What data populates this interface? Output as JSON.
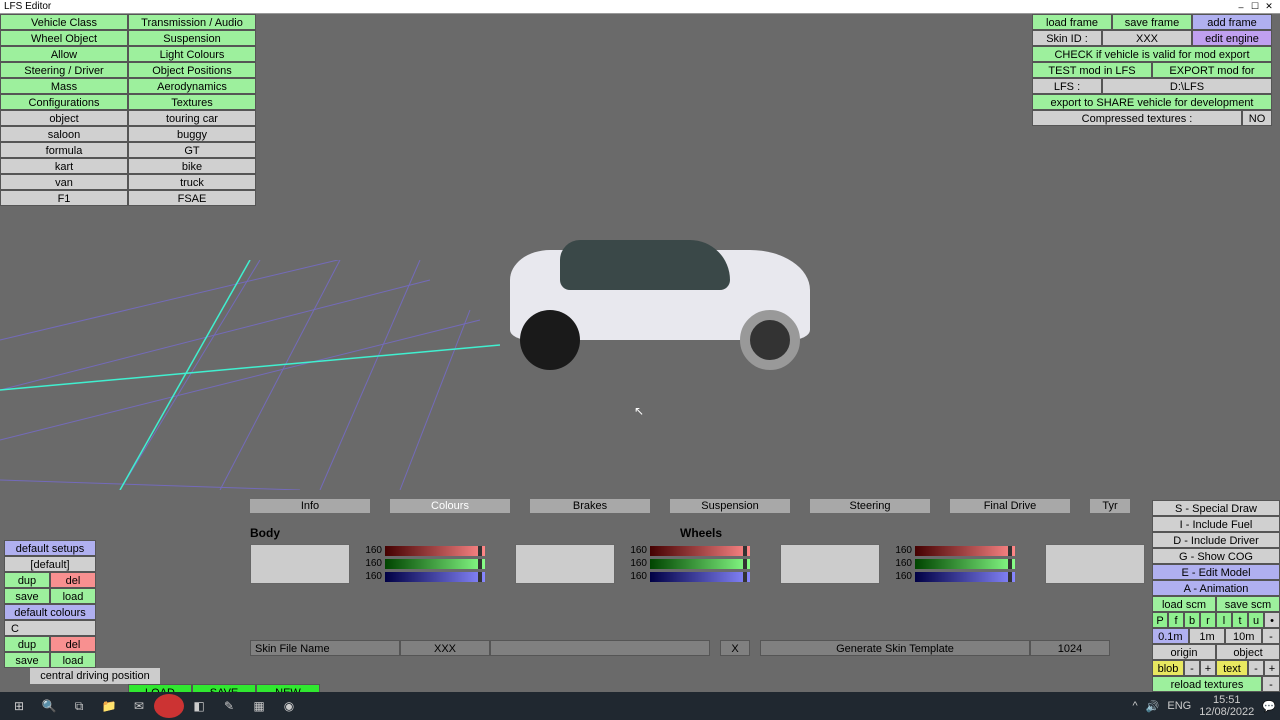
{
  "window": {
    "title": "LFS Editor",
    "min": "–",
    "max": "☐",
    "close": "✕"
  },
  "left_tabs": [
    [
      "Vehicle Class",
      "Transmission / Audio"
    ],
    [
      "Wheel Object",
      "Suspension"
    ],
    [
      "Allow",
      "Light Colours"
    ],
    [
      "Steering / Driver",
      "Object Positions"
    ],
    [
      "Mass",
      "Aerodynamics"
    ],
    [
      "Configurations",
      "Textures"
    ]
  ],
  "class_grid": [
    [
      "object",
      "touring car"
    ],
    [
      "saloon",
      "buggy"
    ],
    [
      "formula",
      "GT"
    ],
    [
      "kart",
      "bike"
    ],
    [
      "van",
      "truck"
    ],
    [
      "F1",
      "FSAE"
    ]
  ],
  "top_right": {
    "row1": [
      "load frame",
      "save frame",
      "add frame"
    ],
    "skin_id_label": "Skin ID :",
    "skin_id_value": "XXX",
    "edit_engine": "edit engine",
    "check": "CHECK if vehicle is valid for mod export",
    "row4": [
      "TEST mod in LFS",
      "EXPORT mod for UPLOAD"
    ],
    "lfs_label": "LFS :",
    "lfs_value": "D:\\LFS",
    "export_dev": "export to SHARE vehicle for development",
    "comp_tex_label": "Compressed textures :",
    "comp_tex_val": "NO"
  },
  "bottom_tabs": [
    "Info",
    "Colours",
    "Brakes",
    "Suspension",
    "Steering",
    "Final Drive",
    "Tyr"
  ],
  "body_title": "Body",
  "wheels_title": "Wheels",
  "slider_val": "160",
  "skin": {
    "label": "Skin File Name",
    "value": "XXX",
    "x": "X",
    "gen": "Generate Skin Template",
    "size": "1024"
  },
  "setups": {
    "default_setups": "default setups",
    "default_item": "[default]",
    "dup": "dup",
    "del": "del",
    "save": "save",
    "load": "load",
    "default_colours": "default colours",
    "c": "C",
    "central": "central driving position",
    "LOAD": "LOAD",
    "SAVE": "SAVE",
    "NEW": "NEW"
  },
  "help": [
    "S - Special Draw",
    "I - Include Fuel",
    "D - Include Driver",
    "G - Show COG",
    "E - Edit Model",
    "A - Animation"
  ],
  "scm": {
    "load": "load scm",
    "save": "save scm"
  },
  "letters": [
    "P",
    "f",
    "b",
    "r",
    "l",
    "t",
    "u"
  ],
  "dist": [
    "0.1m",
    "1m",
    "10m",
    "-"
  ],
  "orig": [
    "origin",
    "object"
  ],
  "blob": [
    "blob",
    "-",
    "+",
    "text",
    "-",
    "+"
  ],
  "reload": "reload textures",
  "taskbar": {
    "time": "15:51",
    "date": "12/08/2022",
    "lang": "ENG"
  }
}
